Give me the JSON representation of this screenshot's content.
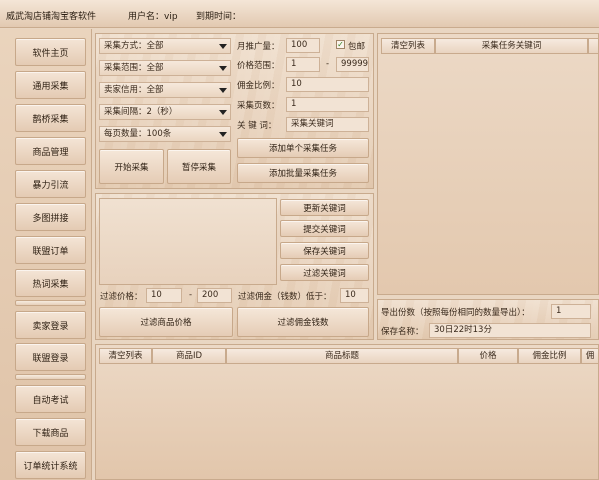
{
  "titlebar": {
    "app_name": "威武淘店铺淘宝客软件",
    "username_label": "用户名：vip",
    "expiry_label": "到期时间："
  },
  "sidebar": {
    "items": [
      "软件主页",
      "通用采集",
      "鹊桥采集",
      "商品管理",
      "暴力引流",
      "多图拼接",
      "联盟订单",
      "热词采集",
      "卖家登录",
      "联盟登录",
      "自动考试",
      "下载商品",
      "订单统计系统"
    ]
  },
  "collect": {
    "method": "采集方式：全部",
    "range": "采集范围：全部",
    "credit": "卖家信用：全部",
    "interval": "采集间隔：2（秒）",
    "per_page": "每页数量：100条",
    "start_label": "开始采集",
    "pause_label": "暂停采集",
    "monthly_label": "月推广量：",
    "monthly_value": "100",
    "free_ship_label": "包邮",
    "price_label": "价格范围：",
    "price_min": "1",
    "price_dash": "-",
    "price_max": "99999",
    "commission_label": "佣金比例：",
    "commission_value": "10",
    "pages_label": "采集页数：",
    "pages_value": "1",
    "keyword_label": "关 键 词：",
    "keyword_value": "采集关键词",
    "add_single_label": "添加单个采集任务",
    "add_batch_label": "添加批量采集任务"
  },
  "task_list": {
    "clear_label": "清空列表",
    "col_keyword": "采集任务关键词"
  },
  "keywords": {
    "update_label": "更新关键词",
    "submit_label": "提交关键词",
    "save_label": "保存关键词",
    "filter_label": "过滤关键词"
  },
  "filter": {
    "price_label": "过滤价格：",
    "price_min": "10",
    "price_dash": "-",
    "price_max": "200",
    "commission_label": "过滤佣金（钱数）低于：",
    "commission_value": "10",
    "filter_price_label": "过滤商品价格",
    "filter_commission_label": "过滤佣金钱数"
  },
  "export": {
    "count_label": "导出份数（按照每份相同的数量导出）：",
    "count_value": "1",
    "name_label": "保存名称：",
    "name_value": "30日22时13分"
  },
  "product_table": {
    "clear_label": "清空列表",
    "columns": [
      "商品ID",
      "商品标题",
      "价格",
      "佣金比例",
      "佣"
    ]
  }
}
